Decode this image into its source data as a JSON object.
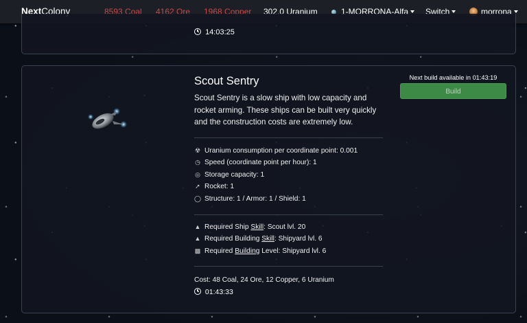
{
  "nav": {
    "brand_bold": "Next",
    "brand_rest": "Colony",
    "coal": "8593 Coal",
    "ore": "4162 Ore",
    "copper": "1968 Copper",
    "uranium": "302.0 Uranium",
    "planet": "1-MORRONA-Alfa",
    "switch": "Switch",
    "user": "morrona"
  },
  "prev_card": {
    "time": "14:03:25"
  },
  "ship": {
    "name": "Scout Sentry",
    "description": "Scout Sentry is a slow ship with low capacity and rocket arming. These ships can be built very quickly and the construction costs are extremely low.",
    "stats": {
      "uranium": "Uranium consumption per coordinate point: 0.001",
      "speed": "Speed (coordinate point per hour): 1",
      "storage": "Storage capacity: 1",
      "rocket": "Rocket: 1",
      "structure": "Structure: 1 / Armor: 1 / Shield: 1"
    },
    "requirements": {
      "ship_skill_pre": "Required Ship ",
      "ship_skill_link": "Skill",
      "ship_skill_post": ": Scout lvl. 20",
      "building_skill_pre": "Required Building ",
      "building_skill_link": "Skill",
      "building_skill_post": ": Shipyard lvl. 6",
      "building_level_pre": "Required ",
      "building_level_link": "Building",
      "building_level_post": " Level: Shipyard lvl. 6"
    },
    "cost": "Cost: 48 Coal, 24 Ore, 12 Copper, 6 Uranium",
    "build_time": "01:43:33",
    "next_build": "Next build available in 01:43:19",
    "build_label": "Build"
  },
  "icons": {
    "uranium": "radiation-icon",
    "speed": "gauge-icon",
    "storage": "storage-icon",
    "rocket": "rocket-icon",
    "structure": "shield-icon",
    "skill": "graduation-cap-icon",
    "building": "building-icon",
    "clock": "clock-icon"
  },
  "colors": {
    "resource_red": "#c9484b",
    "build_green": "#3c8a45",
    "navbar": "#1c1f25"
  }
}
